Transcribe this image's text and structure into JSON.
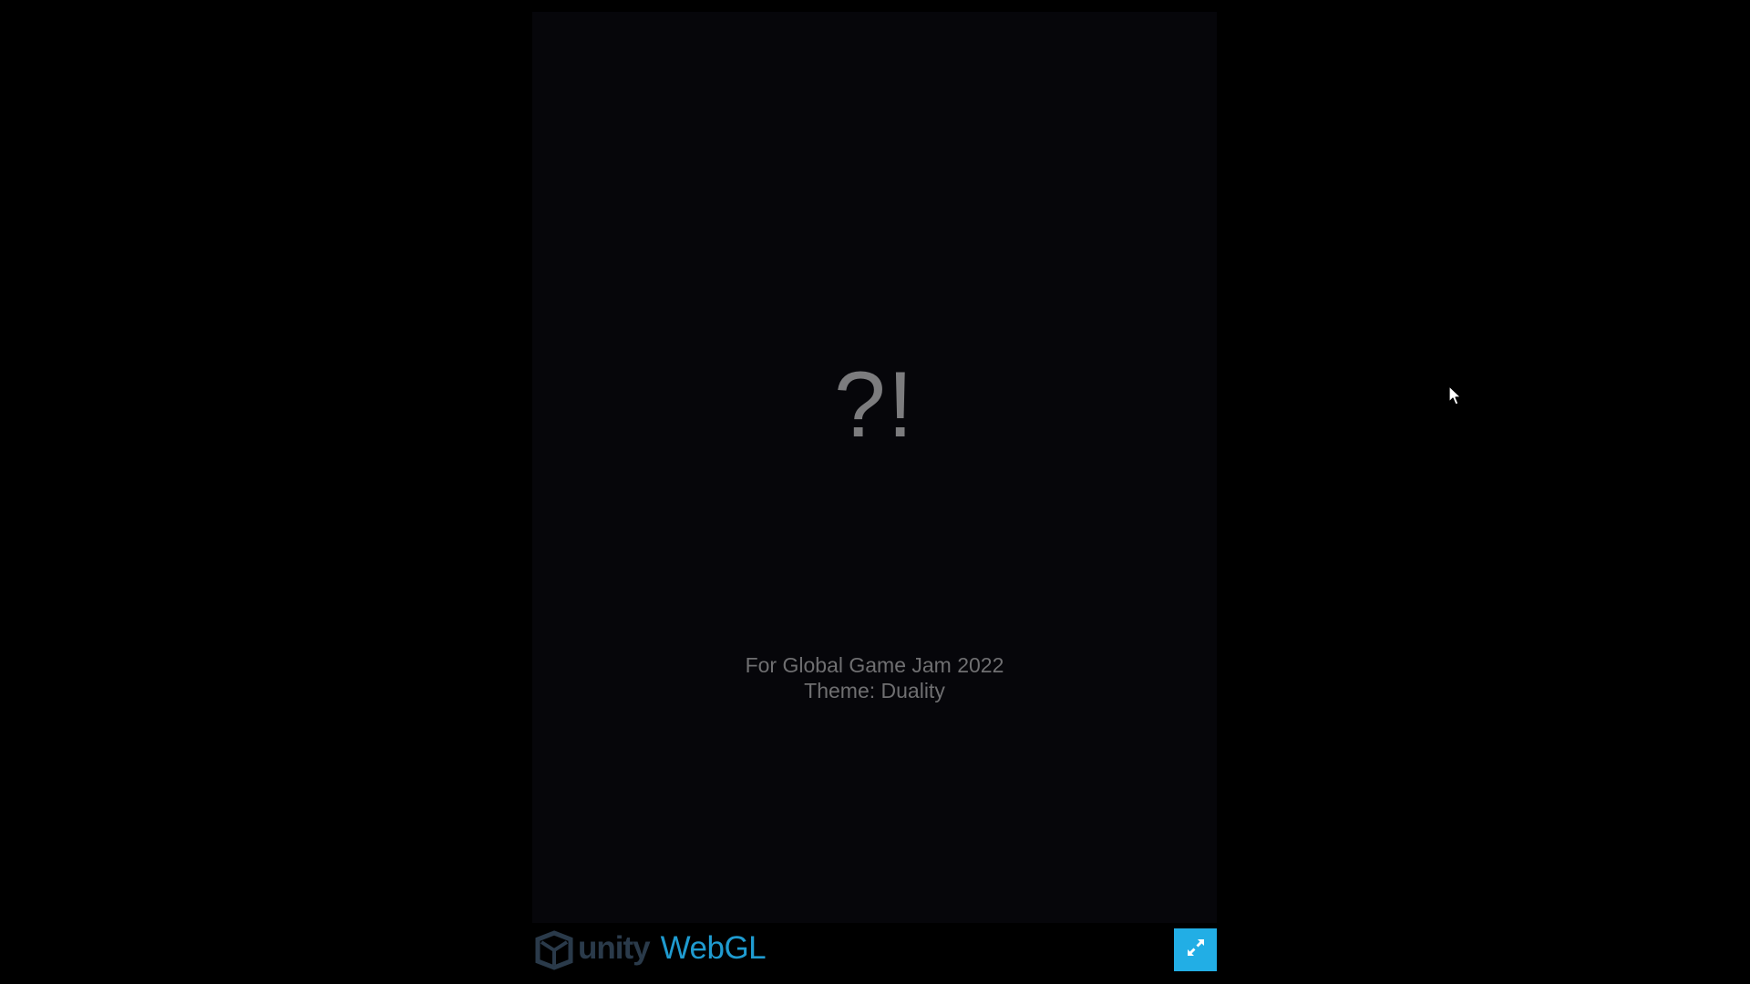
{
  "game": {
    "splash_symbol": "?!",
    "credit_line_1": "For Global Game Jam 2022",
    "credit_line_2": "Theme: Duality"
  },
  "footer": {
    "engine_name": "unity",
    "platform_name": "WebGL",
    "logo_icon": "unity-cube-icon",
    "fullscreen_icon": "expand-arrows-icon"
  },
  "colors": {
    "page_background": "#000000",
    "canvas_background": "#06060a",
    "fullscreen_button": "#22aee5",
    "webgl_text": "#1f9bd0"
  }
}
